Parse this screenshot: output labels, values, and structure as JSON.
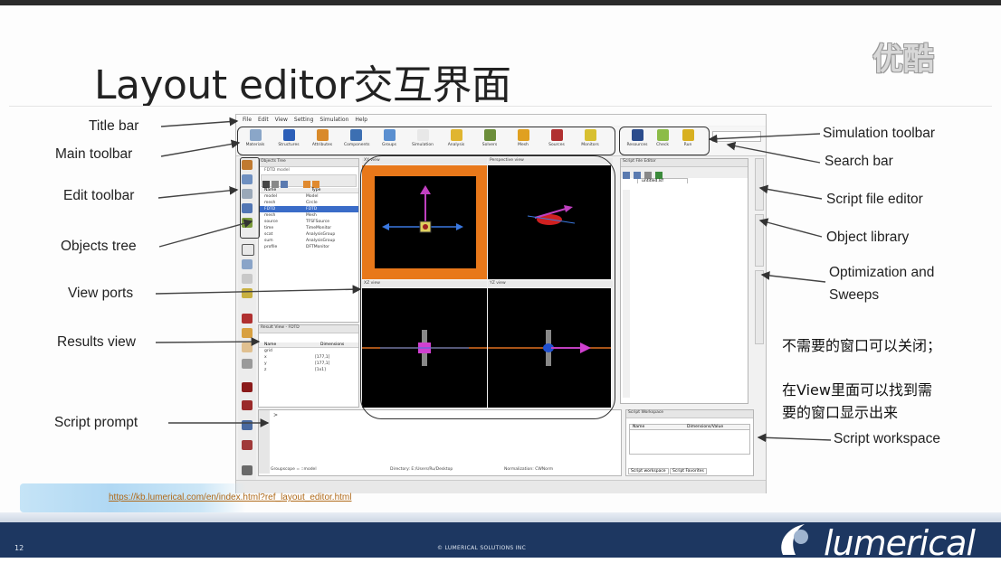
{
  "slide": {
    "title": "Layout editor交互界面",
    "watermark": "优酷",
    "url": "https://kb.lumerical.com/en/index.html?ref_layout_editor.html",
    "page_number": "12",
    "copyright": "© LUMERICAL SOLUTIONS INC",
    "brand": "lumerical"
  },
  "labels_left": {
    "title_bar": "Title bar",
    "main_toolbar": "Main toolbar",
    "edit_toolbar": "Edit toolbar",
    "objects_tree": "Objects tree",
    "view_ports": "View ports",
    "results_view": "Results view",
    "script_prompt": "Script prompt"
  },
  "labels_right": {
    "simulation_toolbar": "Simulation toolbar",
    "search_bar": "Search bar",
    "script_file_editor": "Script file editor",
    "object_library": "Object library",
    "optimization_line1": "Optimization and",
    "optimization_line2": "Sweeps",
    "script_workspace": "Script workspace"
  },
  "notes": {
    "line1": "不需要的窗口可以关闭；",
    "line2": "在View里面可以找到需",
    "line3": "要的窗口显示出来"
  },
  "app": {
    "menu": [
      "File",
      "Edit",
      "View",
      "Setting",
      "Simulation",
      "Help"
    ],
    "toolbar": [
      {
        "label": "Materials",
        "color": "#8aa6c8"
      },
      {
        "label": "Structures",
        "color": "#2c5fb8"
      },
      {
        "label": "Attributes",
        "color": "#d98a2b"
      },
      {
        "label": "Components",
        "color": "#3c6fb2"
      },
      {
        "label": "Groups",
        "color": "#5a8fd0"
      },
      {
        "label": "Simulation",
        "color": "#e8e8e8"
      },
      {
        "label": "Analysis",
        "color": "#e0b530"
      },
      {
        "label": "Solvers",
        "color": "#6c8e3a"
      },
      {
        "label": "Mesh",
        "color": "#e0a020"
      },
      {
        "label": "Sources",
        "color": "#b03030"
      },
      {
        "label": "Monitors",
        "color": "#d8c030"
      }
    ],
    "sim_toolbar": [
      {
        "label": "Resources",
        "color": "#2c4c8c"
      },
      {
        "label": "Check",
        "color": "#8cbc48"
      },
      {
        "label": "Run",
        "color": "#d8b020"
      }
    ],
    "objects_tree": {
      "title": "Objects Tree",
      "subtitle": "FDTD model",
      "headers": [
        "Name",
        "Type"
      ],
      "rows": [
        [
          "model",
          "Model"
        ],
        [
          "mesh",
          "Circle"
        ],
        [
          "FDTD",
          "FDTD"
        ],
        [
          "mesh",
          "Mesh"
        ],
        [
          "source",
          "TFSFSource"
        ],
        [
          "time",
          "TimeMonitor"
        ],
        [
          "scat",
          "AnalysisGroup"
        ],
        [
          "sum",
          "AnalysisGroup"
        ],
        [
          "profile",
          "DFTMonitor"
        ]
      ]
    },
    "results": {
      "title": "Result View - FDTD",
      "headers": [
        "Name",
        "Dimensions"
      ],
      "rows": [
        [
          "grid",
          ""
        ],
        [
          "x",
          "[177,1]"
        ],
        [
          "y",
          "[177,1]"
        ],
        [
          "z",
          "[1x1]"
        ]
      ]
    },
    "viewports": [
      "XY view",
      "Perspective view",
      "XZ view",
      "YZ view"
    ],
    "script_file": {
      "title": "Script File Editor",
      "tab": "untitled.lsf"
    },
    "script_workspace": {
      "title": "Script Workspace",
      "headers": [
        "Name",
        "Dimensions/Value"
      ],
      "tabs": [
        "Script workspace",
        "Script Favorites"
      ]
    },
    "status": {
      "groupscope": "Groupscope = ::model",
      "directory": "Directory: E:/Users/Ru/Desktop",
      "normalization": "Normalization: CWNorm"
    },
    "side_tabs": [
      "Script File Editor",
      "Object Library",
      "Optimization and Sweeps"
    ]
  }
}
